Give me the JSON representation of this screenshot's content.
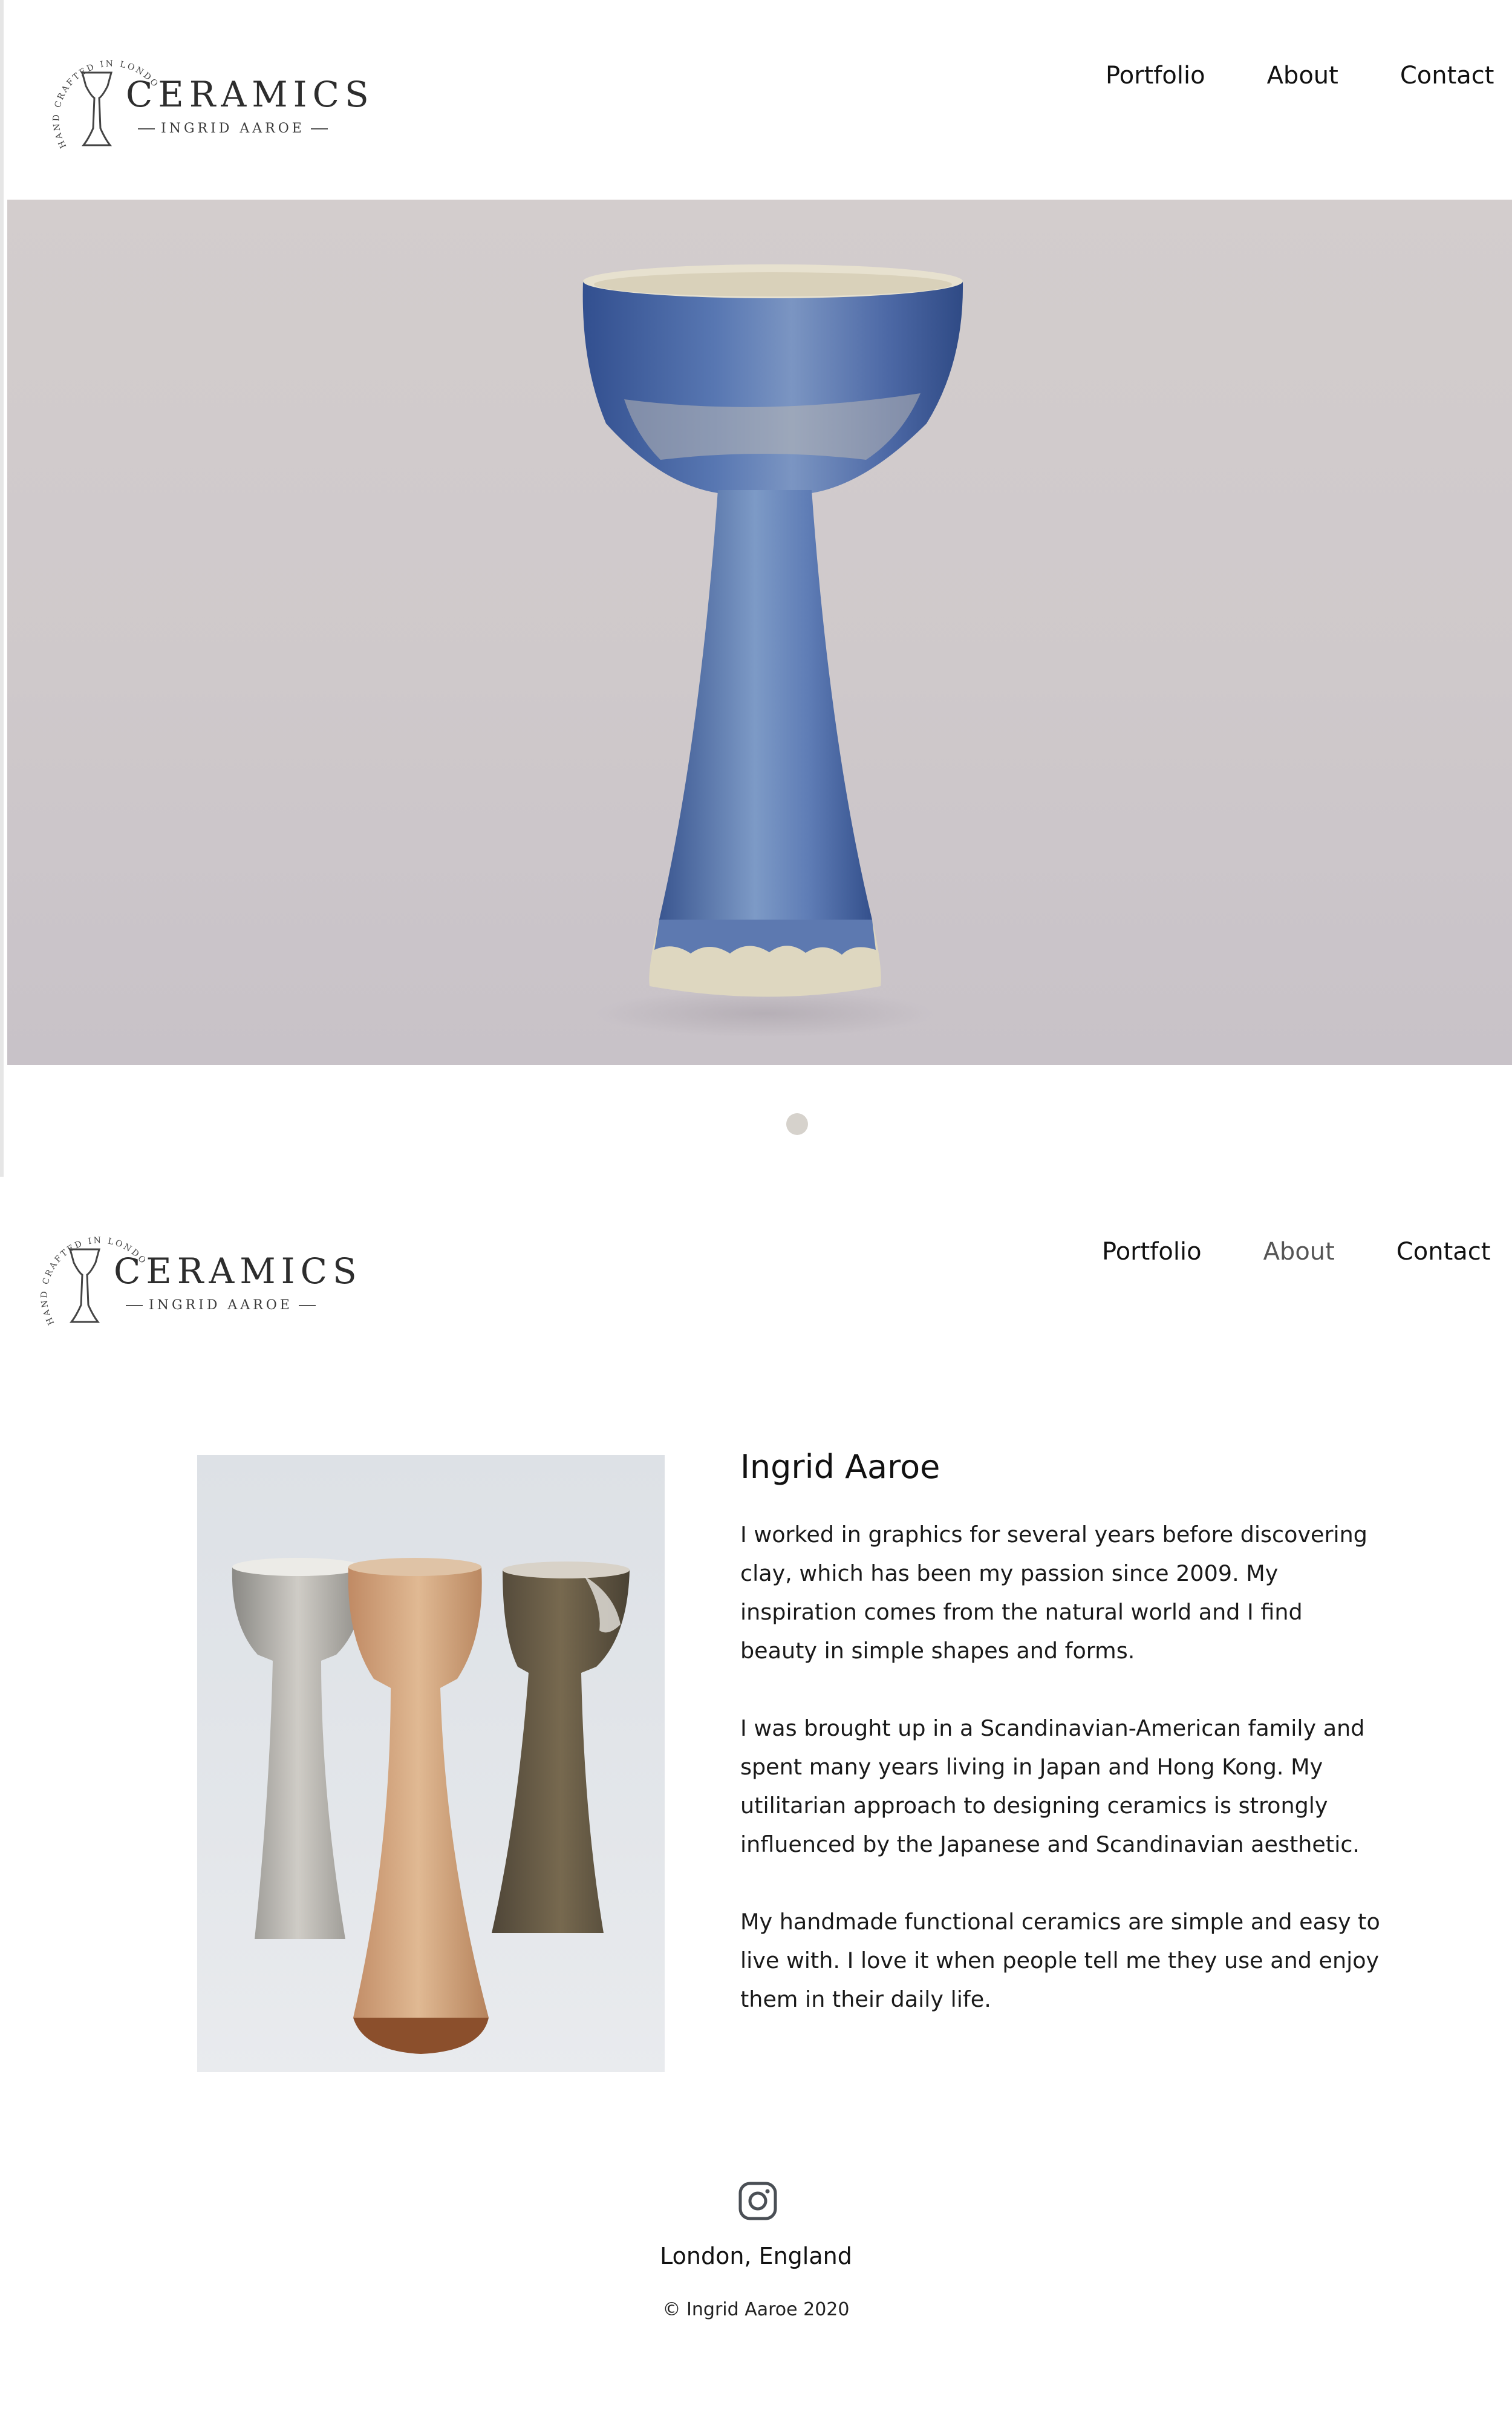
{
  "brand": {
    "name": "CERAMICS",
    "subtitle": "INGRID AAROE",
    "arc_text": "HAND CRAFTED IN LONDON",
    "logo_icon": "goblet-icon"
  },
  "nav": {
    "items": [
      {
        "label": "Portfolio"
      },
      {
        "label": "About"
      },
      {
        "label": "Contact"
      }
    ]
  },
  "hero": {
    "image": "blue-glazed-goblet-photo",
    "slides": 1,
    "active_slide": 1
  },
  "about": {
    "active_nav": "About",
    "image": "three-goblets-photo",
    "title": "Ingrid Aaroe",
    "paragraphs": [
      "I worked in graphics for several years before discovering clay, which has been my passion since 2009. My inspiration comes from the natural world and I find beauty in simple shapes and forms.",
      "I was brought up in a Scandinavian-American family and spent many years living in Japan and Hong Kong. My utilitarian approach to designing ceramics is strongly influenced by the Japanese and Scandinavian aesthetic.",
      "My handmade functional ceramics are simple and easy to live with. I love it when people tell me they use and enjoy them in their daily life."
    ]
  },
  "footer": {
    "social_icon": "instagram-icon",
    "location": "London, England",
    "copyright": "© Ingrid Aaroe 2020"
  },
  "colors": {
    "text": "#111111",
    "nav_active": "#555555",
    "hero_bg": "#cfc9cb",
    "glaze_blue": "#3f5fa0",
    "dot": "#d6d2cc"
  }
}
